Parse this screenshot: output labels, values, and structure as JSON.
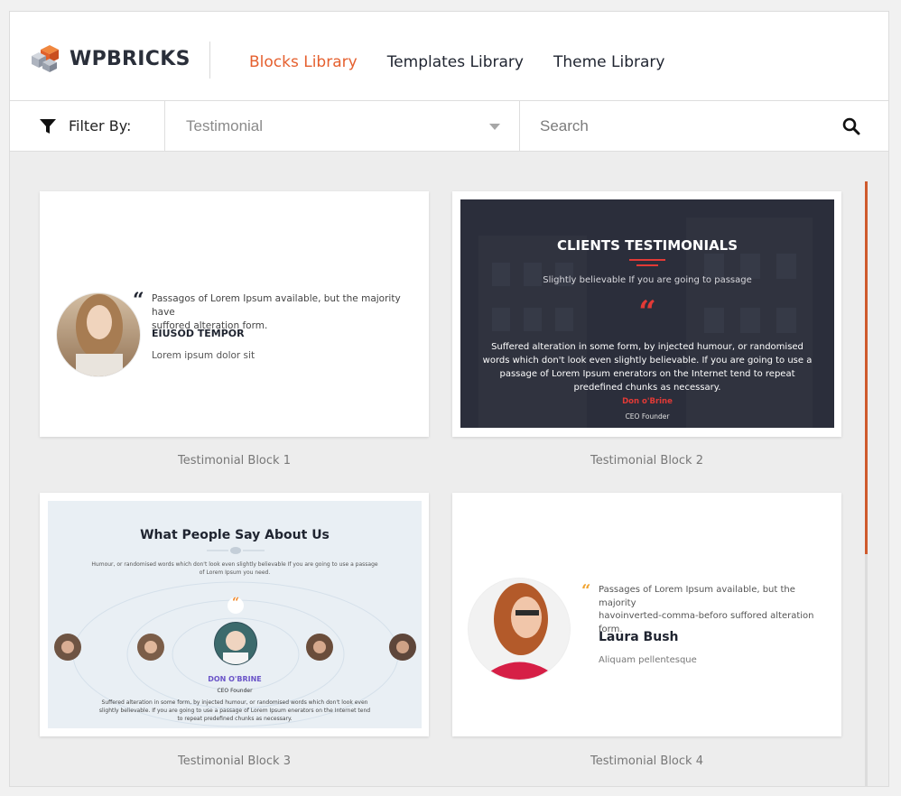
{
  "brand": {
    "name": "WPBRICKS"
  },
  "nav": [
    {
      "label": "Blocks Library",
      "active": true
    },
    {
      "label": "Templates Library",
      "active": false
    },
    {
      "label": "Theme Library",
      "active": false
    }
  ],
  "filter": {
    "label": "Filter By:",
    "selected": "Testimonial"
  },
  "search": {
    "placeholder": "Search"
  },
  "colors": {
    "accent": "#e5602f",
    "scroll": "#cf5a2d",
    "dark_card": "#2b2e3b",
    "red": "#e23a36"
  },
  "blocks": [
    {
      "caption": "Testimonial Block 1",
      "quote": "Passagos of Lorem Ipsum available, but the majority have",
      "quote2": "suffored alteration form.",
      "name": "EIUSOD TEMPOR",
      "role": "Lorem ipsum dolor sit"
    },
    {
      "caption": "Testimonial Block 2",
      "title": "CLIENTS TESTIMONIALS",
      "subtitle": "Slightly believable If you are going to passage",
      "quote_lines": [
        "Suffered alteration in some form, by injected humour, or randomised",
        "words which don't look even slightly believable. If you are going to use a",
        "passage of Lorem Ipsum enerators on the Internet tend to repeat",
        "predefined chunks as necessary."
      ],
      "name": "Don o'Brine",
      "role": "CEO Founder"
    },
    {
      "caption": "Testimonial Block 3",
      "title": "What People Say About Us",
      "subtitle_lines": [
        "Humour, or randomised words which don't look even slightly believable If you are going to use a passage",
        "of Lorem Ipsum you need."
      ],
      "name": "DON O'BRINE",
      "role": "CEO Founder",
      "quote_lines": [
        "Suffered alteration in some form, by injected humour, or randomised words which don't look even",
        "slightly believable. If you are going to use a passage of Lorem Ipsum enerators on the Internet tend",
        "to repeat predefined chunks as necessary."
      ]
    },
    {
      "caption": "Testimonial Block 4",
      "quote_lines": [
        "Passages of Lorem Ipsum available, but the majority",
        "havoinverted-comma-beforo suffored alteration",
        "form."
      ],
      "name": "Laura Bush",
      "role": "Aliquam pellentesque"
    }
  ]
}
